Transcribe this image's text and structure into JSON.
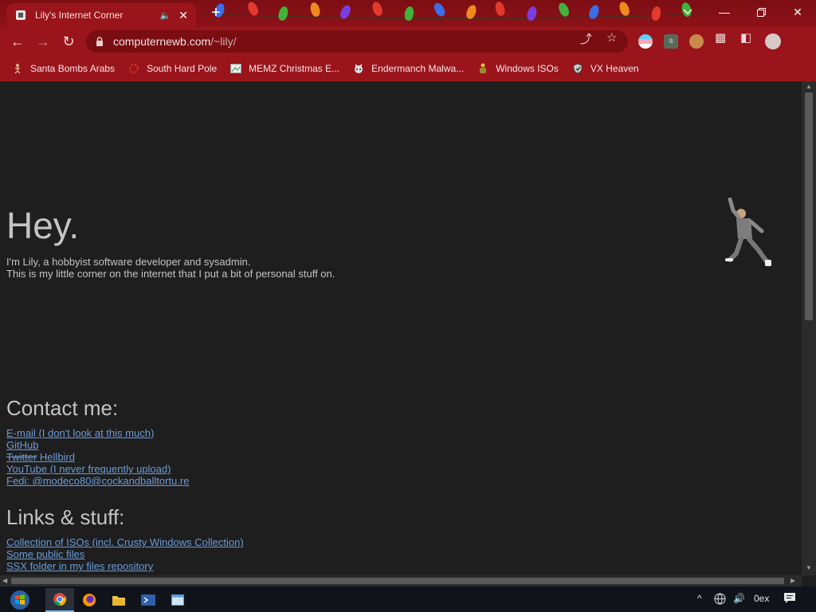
{
  "browser": {
    "tab_title": "Lily's Internet Corner",
    "url_host": "computernewb.com",
    "url_path": "/~lily/",
    "bookmarks": [
      {
        "label": "Santa Bombs Arabs",
        "icon": "figure-icon"
      },
      {
        "label": "South Hard Pole",
        "icon": "flower-icon"
      },
      {
        "label": "MEMZ Christmas E...",
        "icon": "image-icon"
      },
      {
        "label": "Endermanch Malwa...",
        "icon": "cat-icon"
      },
      {
        "label": "Windows ISOs",
        "icon": "figure-icon"
      },
      {
        "label": "VX Heaven",
        "icon": "shield-icon"
      }
    ]
  },
  "page": {
    "heading": "Hey.",
    "intro_line1": "I'm Lily, a hobbyist software developer and sysadmin.",
    "intro_line2": "This is my little corner on the internet that I put a bit of personal stuff on.",
    "contact_heading": "Contact me:",
    "contact_links": {
      "email": "E-mail (I don't look at this much)",
      "github": "GitHub",
      "twitter_old": "Twitter",
      "twitter_new": "Hellbird",
      "youtube": "YouTube (I never frequently upload)",
      "fedi": "Fedi: @modeco80@cockandballtortu.re"
    },
    "links_heading": "Links & stuff:",
    "stuff_links": [
      "Collection of ISOs (incl. Crusty Windows Collection)",
      "Some public files",
      "SSX folder in my files repository"
    ]
  },
  "taskbar": {
    "clock": "0ex"
  },
  "colors": {
    "frame": "#9a141b",
    "titlebar": "#8e1218",
    "page_bg": "#1e1e1f",
    "link": "#6c9bd6",
    "text": "#c4c4c4"
  }
}
